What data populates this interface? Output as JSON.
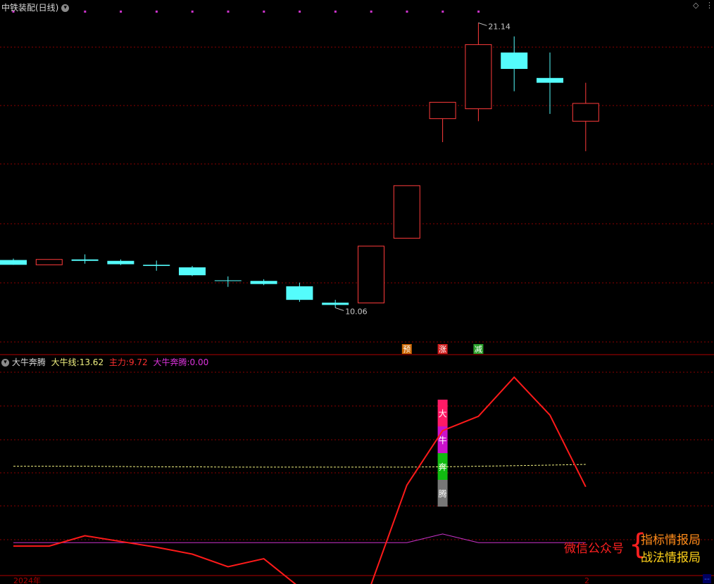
{
  "window": {
    "title": "中铁装配(日线)",
    "indicator_name": "大牛奔腾",
    "diamond_icon": "diamond-icon",
    "collapse_icon": "chevron-down-icon"
  },
  "indicator_values": {
    "daniu_label": "大牛线:",
    "daniu_value": "13.62",
    "zhuli_label": "主力:",
    "zhuli_value": "9.72",
    "bente_label": "大牛奔腾:",
    "bente_value": "0.00"
  },
  "colors": {
    "up": "#ff3b3b",
    "down": "#54fcfc",
    "grid": "#8b0000",
    "zhuli": "#ff1a1a",
    "daniu": "#f0f080",
    "bente": "#cc33cc",
    "marker": "#cc33cc"
  },
  "chart_data": [
    {
      "type": "candlestick",
      "title": "中铁装配(日线)",
      "ylim": [
        10.0,
        21.5
      ],
      "candles": [
        {
          "o": 12.75,
          "h": 12.8,
          "l": 12.58,
          "c": 12.58
        },
        {
          "o": 12.58,
          "h": 12.77,
          "l": 12.58,
          "c": 12.77
        },
        {
          "o": 12.77,
          "h": 12.95,
          "l": 12.62,
          "c": 12.72
        },
        {
          "o": 12.72,
          "h": 12.77,
          "l": 12.57,
          "c": 12.6
        },
        {
          "o": 12.58,
          "h": 12.73,
          "l": 12.37,
          "c": 12.54
        },
        {
          "o": 12.49,
          "h": 12.54,
          "l": 12.18,
          "c": 12.21
        },
        {
          "o": 12.03,
          "h": 12.17,
          "l": 11.8,
          "c": 12.01
        },
        {
          "o": 12.01,
          "h": 12.07,
          "l": 11.86,
          "c": 11.9
        },
        {
          "o": 11.82,
          "h": 11.95,
          "l": 11.27,
          "c": 11.34
        },
        {
          "o": 11.24,
          "h": 11.34,
          "l": 11.06,
          "c": 11.16
        },
        {
          "o": 11.23,
          "h": 13.24,
          "l": 11.23,
          "c": 13.24
        },
        {
          "o": 13.52,
          "h": 15.38,
          "l": 13.52,
          "c": 15.38
        },
        {
          "o": 17.75,
          "h": 18.33,
          "l": 16.92,
          "c": 18.33
        },
        {
          "o": 18.1,
          "h": 21.14,
          "l": 17.66,
          "c": 20.37
        },
        {
          "o": 20.09,
          "h": 20.66,
          "l": 18.72,
          "c": 19.51
        },
        {
          "o": 19.19,
          "h": 20.09,
          "l": 17.92,
          "c": 19.02
        },
        {
          "o": 17.66,
          "h": 19.02,
          "l": 16.6,
          "c": 18.29
        }
      ],
      "annotations": [
        {
          "label": "21.14",
          "candle": 13,
          "at": "high"
        },
        {
          "label": "10.06",
          "candle": 9,
          "at": "low"
        }
      ],
      "markers_top_count": 13,
      "signals": [
        {
          "candle": 11,
          "text": "预",
          "color": "#cc6600"
        },
        {
          "candle": 12,
          "text": "涨",
          "color": "#d02020"
        },
        {
          "candle": 13,
          "text": "减",
          "color": "#2aa02a"
        }
      ]
    },
    {
      "type": "line",
      "title": "大牛奔腾",
      "ylim": [
        -5,
        32
      ],
      "series": [
        {
          "name": "主力",
          "values": [
            -0.6,
            -0.6,
            1.2,
            0.2,
            -0.8,
            -2.0,
            -4.2,
            -2.8,
            -7.8,
            -8.2,
            -7.3,
            10.0,
            19.5,
            22.0,
            28.8,
            22.2,
            9.72
          ]
        },
        {
          "name": "大牛线",
          "values": [
            13.3,
            13.3,
            13.3,
            13.25,
            13.2,
            13.2,
            13.15,
            13.15,
            13.15,
            13.15,
            13.15,
            13.15,
            13.2,
            13.3,
            13.4,
            13.5,
            13.62
          ]
        },
        {
          "name": "大牛奔腾",
          "values": [
            0,
            0,
            0,
            0,
            0,
            0,
            0,
            0,
            0,
            0,
            0,
            0,
            1.5,
            0,
            0,
            0,
            0
          ]
        }
      ],
      "bar_labels": [
        "大",
        "牛",
        "奔",
        "腾"
      ],
      "bar_colors": [
        "#ff1a66",
        "#cc11cc",
        "#11bb11",
        "#777777"
      ],
      "bar_candle": 12,
      "x_label_left": "2024年",
      "x_label_right": "2"
    }
  ],
  "watermark": {
    "left": "微信公众号",
    "brace": "{",
    "line1": "指标情报局",
    "line2": "战法情报局"
  },
  "corner": "--"
}
